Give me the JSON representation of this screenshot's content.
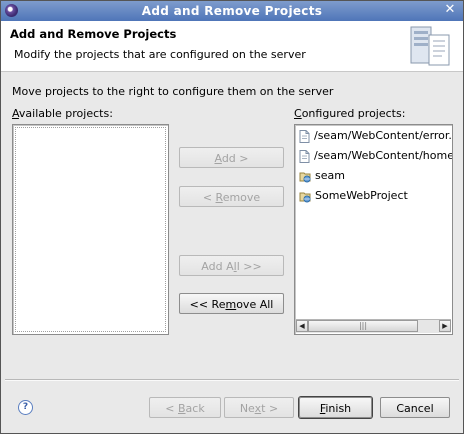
{
  "window": {
    "title": "Add and Remove Projects",
    "close_glyph": "✕"
  },
  "banner": {
    "title": "Add and Remove Projects",
    "description": "Modify the projects that are configured on the server",
    "icon": "server-config-icon"
  },
  "instructions": "Move projects to the right to configure them on the server",
  "available": {
    "label_prefix": "",
    "label_mnemonic": "A",
    "label_rest": "vailable projects:",
    "items": []
  },
  "configured": {
    "label_prefix": "",
    "label_mnemonic": "C",
    "label_rest": "onfigured projects:",
    "items": [
      {
        "label": "/seam/WebContent/error.xh",
        "icon": "file-icon"
      },
      {
        "label": "/seam/WebContent/home.x",
        "icon": "file-icon"
      },
      {
        "label": "seam",
        "icon": "web-project-icon"
      },
      {
        "label": "SomeWebProject",
        "icon": "web-project-icon"
      }
    ]
  },
  "buttons": {
    "add": {
      "prefix": "",
      "mnemonic": "A",
      "rest": "dd >",
      "enabled": false
    },
    "remove": {
      "prefix": "< ",
      "mnemonic": "R",
      "rest": "emove",
      "enabled": false
    },
    "add_all": {
      "prefix": "Add A",
      "mnemonic": "l",
      "rest": "l >>",
      "enabled": false
    },
    "remove_all": {
      "prefix": "<< Re",
      "mnemonic": "m",
      "rest": "ove All",
      "enabled": true
    }
  },
  "footer": {
    "help_glyph": "?",
    "back": {
      "prefix": "< ",
      "mnemonic": "B",
      "rest": "ack",
      "enabled": false
    },
    "next": {
      "prefix": "Ne",
      "mnemonic": "x",
      "rest": "t >",
      "enabled": false
    },
    "finish": {
      "prefix": "",
      "mnemonic": "F",
      "rest": "inish",
      "enabled": true
    },
    "cancel": {
      "label": "Cancel",
      "enabled": true
    }
  },
  "scrollbar": {
    "left_glyph": "◀",
    "right_glyph": "▶",
    "thumb_glyph": "|||"
  },
  "colors": {
    "titlebar_top": "#7e9ccd",
    "titlebar_bottom": "#4f75b8",
    "dialog_bg": "#e9e9e9"
  }
}
